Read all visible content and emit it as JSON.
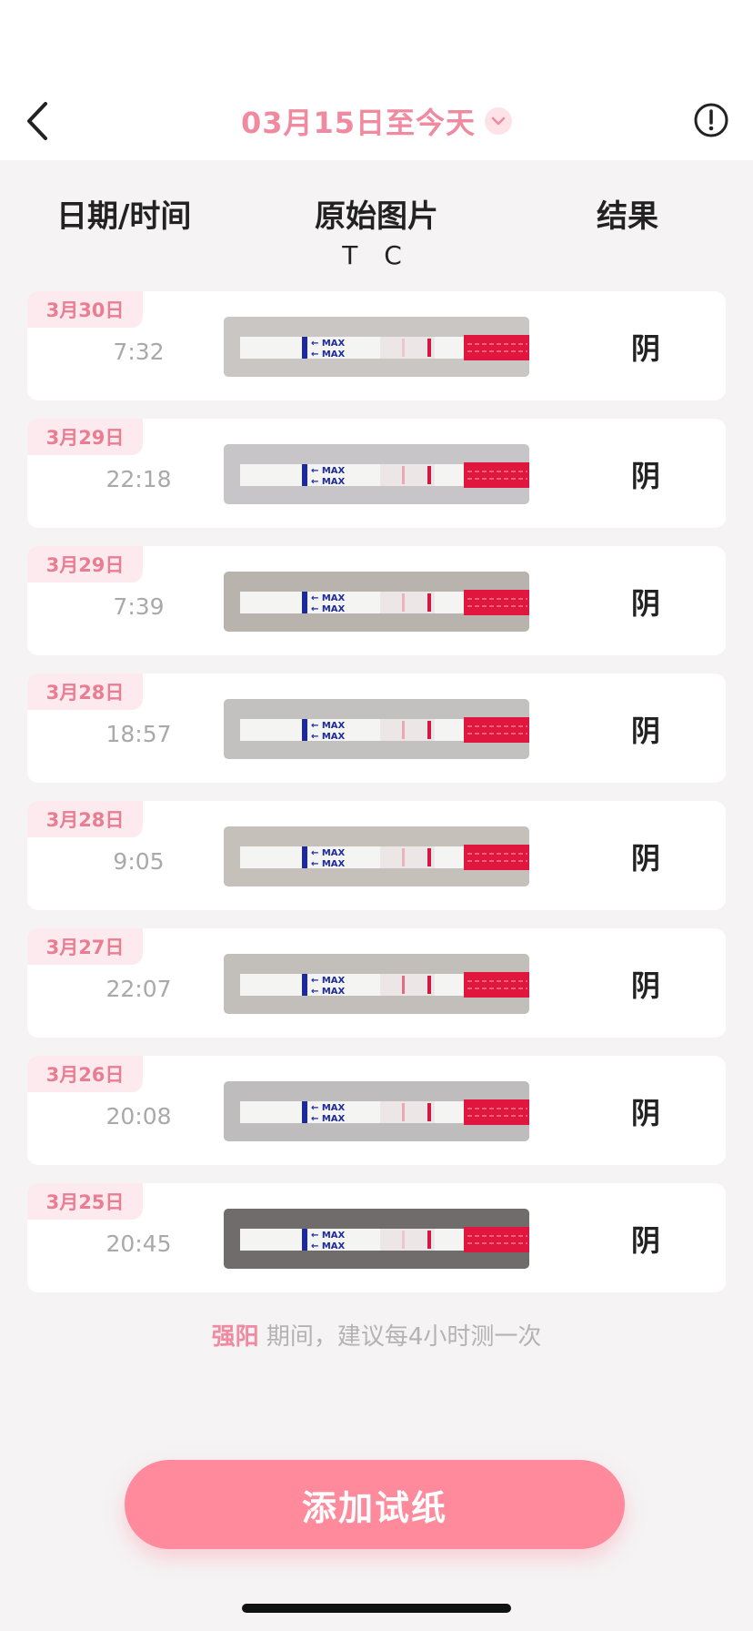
{
  "header": {
    "title": "03月15日至今天",
    "back_icon": "chevron-left-icon",
    "dropdown_icon": "chevron-down-icon",
    "info_icon": "exclamation-circle-icon"
  },
  "columns": {
    "date_time": "日期/时间",
    "image": "原始图片",
    "image_sub": "T C",
    "result": "结果"
  },
  "records": [
    {
      "date": "3月30日",
      "time": "7:32",
      "result": "阴",
      "t_line": 0.05
    },
    {
      "date": "3月29日",
      "time": "22:18",
      "result": "阴",
      "t_line": 0.1
    },
    {
      "date": "3月29日",
      "time": "7:39",
      "result": "阴",
      "t_line": 0.08
    },
    {
      "date": "3月28日",
      "time": "18:57",
      "result": "阴",
      "t_line": 0.1
    },
    {
      "date": "3月28日",
      "time": "9:05",
      "result": "阴",
      "t_line": 0.08
    },
    {
      "date": "3月27日",
      "time": "22:07",
      "result": "阴",
      "t_line": 0.2
    },
    {
      "date": "3月26日",
      "time": "20:08",
      "result": "阴",
      "t_line": 0.1
    },
    {
      "date": "3月25日",
      "time": "20:45",
      "result": "阴",
      "t_line": 0.05
    }
  ],
  "hint": {
    "highlight": "强阳",
    "text": " 期间，建议每4小时测一次"
  },
  "add_button": "添加试纸",
  "colors": {
    "accent": "#f08aa0",
    "button": "#ff8a9c",
    "tag_bg": "#fdeaee",
    "strip_red": "#e0163e"
  }
}
